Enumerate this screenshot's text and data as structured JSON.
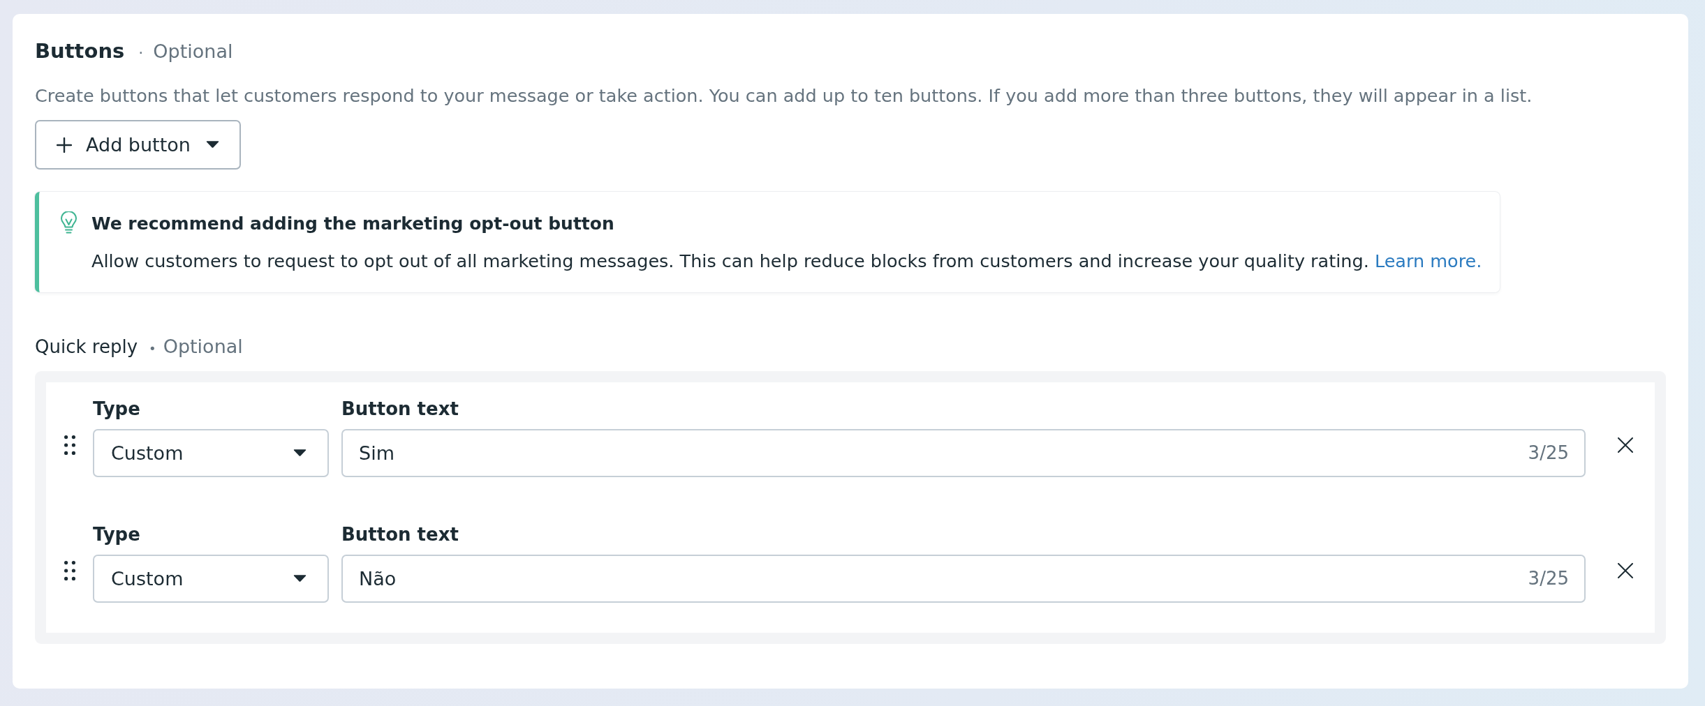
{
  "section": {
    "title": "Buttons",
    "separator": "·",
    "optional_label": "Optional",
    "description": "Create buttons that let customers respond to your message or take action. You can add up to ten buttons. If you add more than three buttons, they will appear in a list."
  },
  "add_button": {
    "label": "Add button"
  },
  "callout": {
    "title": "We recommend adding the marketing opt-out button",
    "body": "Allow customers to request to opt out of all marketing messages. This can help reduce blocks from customers and increase your quality rating.",
    "link": "Learn more."
  },
  "quick_reply": {
    "title": "Quick reply",
    "separator": "•",
    "optional_label": "Optional",
    "rows": [
      {
        "type_label": "Type",
        "type_value": "Custom",
        "text_label": "Button text",
        "text_value": "Sim",
        "counter": "3/25"
      },
      {
        "type_label": "Type",
        "type_value": "Custom",
        "text_label": "Button text",
        "text_value": "Não",
        "counter": "3/25"
      }
    ]
  }
}
